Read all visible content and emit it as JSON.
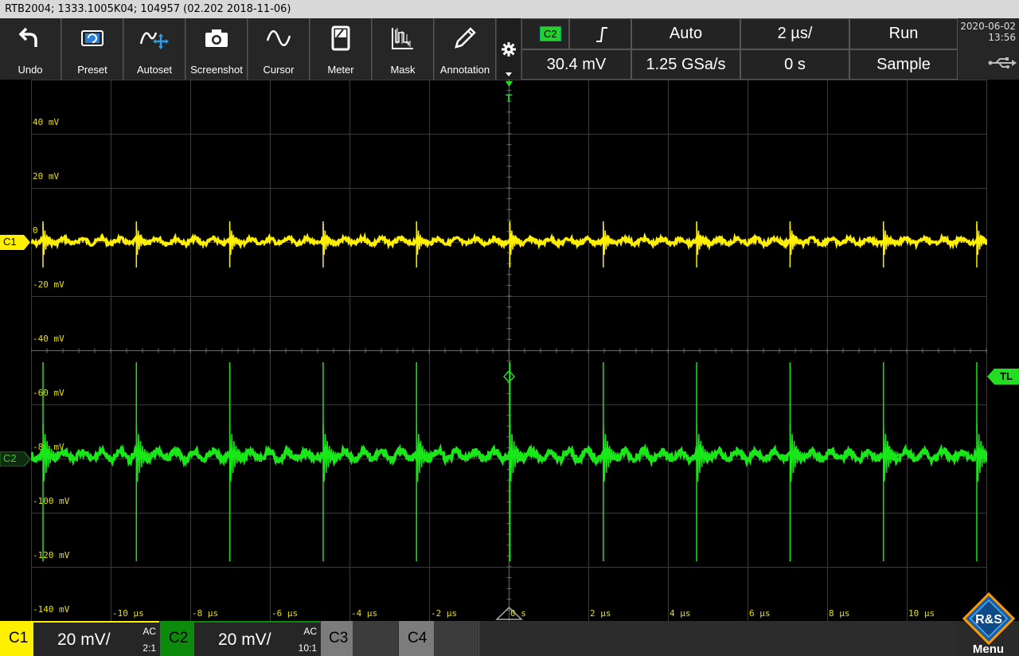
{
  "title_bar": {
    "text": "RTB2004; 1333.1005K04; 104957 (02.202 2018-11-06)"
  },
  "toolbar": {
    "buttons": [
      {
        "label": "Undo",
        "icon": "undo-icon"
      },
      {
        "label": "Preset",
        "icon": "preset-icon"
      },
      {
        "label": "Autoset",
        "icon": "autoset-icon"
      },
      {
        "label": "Screenshot",
        "icon": "camera-icon"
      },
      {
        "label": "Cursor",
        "icon": "cursor-icon"
      },
      {
        "label": "Meter",
        "icon": "meter-icon"
      },
      {
        "label": "Mask",
        "icon": "mask-icon"
      },
      {
        "label": "Annotation",
        "icon": "pen-icon"
      }
    ]
  },
  "trigger": {
    "source": "C2",
    "level": "30.4 mV",
    "slope_icon": "rising-edge-icon",
    "mode": "Auto"
  },
  "timebase": {
    "scale": "2 µs/",
    "position": "0 s",
    "sample_rate": "1.25 GSa/s"
  },
  "acquisition": {
    "state": "Run",
    "mode": "Sample"
  },
  "datetime": {
    "date": "2020-06-02",
    "time": "13:56"
  },
  "scope": {
    "y_labels": [
      "40 mV",
      "20 mV",
      "0",
      "-20 mV",
      "-40 mV",
      "-60 mV",
      "-80 mV",
      "-100 mV",
      "-120 mV",
      "-140 mV"
    ],
    "x_labels": [
      "-10 µs",
      "-8 µs",
      "-6 µs",
      "-4 µs",
      "-2 µs",
      "0 s",
      "2 µs",
      "4 µs",
      "6 µs",
      "8 µs",
      "10 µs"
    ],
    "c1_marker": "C1",
    "c2_marker": "C2",
    "trigger_marker": "T",
    "trigger_level_marker": "TL"
  },
  "channels": [
    {
      "name": "C1",
      "scale": "20 mV/",
      "coupling": "AC",
      "probe": "2:1",
      "color": "#ffef00"
    },
    {
      "name": "C2",
      "scale": "20 mV/",
      "coupling": "AC",
      "probe": "10:1",
      "color": "#00c800"
    },
    {
      "name": "C3"
    },
    {
      "name": "C4"
    }
  ],
  "menu": {
    "label": "Menu",
    "logo": "R&S"
  },
  "colors": {
    "c1": "#ffef00",
    "c2": "#18e818",
    "grid": "#3a3a3a",
    "label": "#e8e000"
  }
}
